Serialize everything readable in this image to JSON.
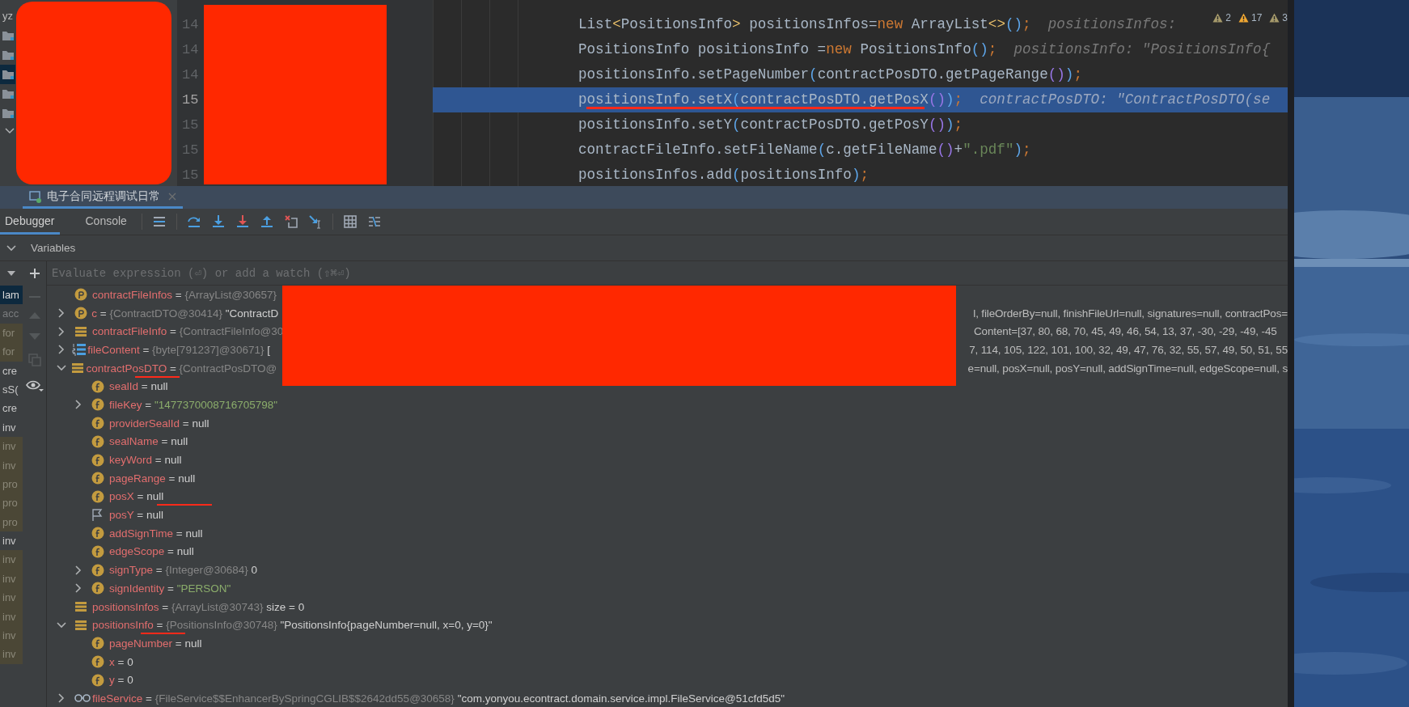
{
  "project_tree": {
    "redacted": true,
    "root_label": "yz",
    "folders": [
      {
        "selected": false
      },
      {
        "selected": false
      },
      {
        "selected": true
      },
      {
        "selected": false
      },
      {
        "selected": false
      }
    ]
  },
  "editor": {
    "gutter_redacted": true,
    "line_numbers": [
      {
        "text": "14",
        "current": false
      },
      {
        "text": "14",
        "current": false
      },
      {
        "text": "14",
        "current": false
      },
      {
        "text": "15",
        "current": true
      },
      {
        "text": "15",
        "current": false
      },
      {
        "text": "15",
        "current": false
      },
      {
        "text": "15",
        "current": false
      }
    ],
    "lines": [
      {
        "selected": false,
        "underlined": false,
        "tokens": [
          {
            "text": "List",
            "kind": "text"
          },
          {
            "text": "<",
            "kind": "generic"
          },
          {
            "text": "PositionsInfo",
            "kind": "text"
          },
          {
            "text": ">",
            "kind": "generic"
          },
          {
            "text": " positionsInfos=",
            "kind": "text"
          },
          {
            "text": "new",
            "kind": "keyword"
          },
          {
            "text": " ArrayList",
            "kind": "text"
          },
          {
            "text": "<>",
            "kind": "generic"
          },
          {
            "text": "()",
            "kind": "paren1"
          },
          {
            "text": ";",
            "kind": "keyword"
          }
        ],
        "hint": "positionsInfos:"
      },
      {
        "selected": false,
        "underlined": false,
        "tokens": [
          {
            "text": "PositionsInfo positionsInfo =",
            "kind": "text"
          },
          {
            "text": "new",
            "kind": "keyword"
          },
          {
            "text": " PositionsInfo",
            "kind": "text"
          },
          {
            "text": "()",
            "kind": "paren1"
          },
          {
            "text": ";",
            "kind": "keyword"
          }
        ],
        "hint": "positionsInfo: \"PositionsInfo{"
      },
      {
        "selected": false,
        "underlined": false,
        "tokens": [
          {
            "text": "positionsInfo.setPageNumber",
            "kind": "text"
          },
          {
            "text": "(",
            "kind": "paren1"
          },
          {
            "text": "contractPosDTO.getPageRange",
            "kind": "text"
          },
          {
            "text": "()",
            "kind": "paren2"
          },
          {
            "text": ")",
            "kind": "paren1"
          },
          {
            "text": ";",
            "kind": "keyword"
          }
        ]
      },
      {
        "selected": true,
        "underlined": true,
        "tokens": [
          {
            "text": "positionsInfo.setX",
            "kind": "text"
          },
          {
            "text": "(",
            "kind": "paren1"
          },
          {
            "text": "contractPosDTO.getPosX",
            "kind": "text"
          },
          {
            "text": "()",
            "kind": "paren2"
          },
          {
            "text": ")",
            "kind": "paren1"
          },
          {
            "text": ";",
            "kind": "keyword"
          }
        ],
        "hint": "contractPosDTO: \"ContractPosDTO(se"
      },
      {
        "selected": false,
        "underlined": false,
        "tokens": [
          {
            "text": "positionsInfo.setY",
            "kind": "text"
          },
          {
            "text": "(",
            "kind": "paren1"
          },
          {
            "text": "contractPosDTO.getPosY",
            "kind": "text"
          },
          {
            "text": "()",
            "kind": "paren2"
          },
          {
            "text": ")",
            "kind": "paren1"
          },
          {
            "text": ";",
            "kind": "keyword"
          }
        ]
      },
      {
        "selected": false,
        "underlined": false,
        "tokens": [
          {
            "text": "contractFileInfo.setFileName",
            "kind": "text"
          },
          {
            "text": "(",
            "kind": "paren1"
          },
          {
            "text": "c.getFileName",
            "kind": "text"
          },
          {
            "text": "()",
            "kind": "paren2"
          },
          {
            "text": "+",
            "kind": "text"
          },
          {
            "text": "\".pdf\"",
            "kind": "string"
          },
          {
            "text": ")",
            "kind": "paren1"
          },
          {
            "text": ";",
            "kind": "keyword"
          }
        ]
      },
      {
        "selected": false,
        "underlined": false,
        "tokens": [
          {
            "text": "positionsInfos.add",
            "kind": "text"
          },
          {
            "text": "(",
            "kind": "paren1"
          },
          {
            "text": "positionsInfo",
            "kind": "text"
          },
          {
            "text": ")",
            "kind": "paren1"
          },
          {
            "text": ";",
            "kind": "keyword"
          }
        ]
      }
    ],
    "inspections": [
      {
        "kind": "weak",
        "count": "2"
      },
      {
        "kind": "warning",
        "count": "17"
      },
      {
        "kind": "weak",
        "count": "3"
      }
    ]
  },
  "tool_window_tab": {
    "label": "电子合同远程调试日常",
    "selected": true
  },
  "debug_tabs": [
    {
      "label": "Debugger",
      "selected": true
    },
    {
      "label": "Console",
      "selected": false
    }
  ],
  "toolbar": [
    {
      "kind": "list"
    },
    {
      "kind": "step-over"
    },
    {
      "kind": "step-into"
    },
    {
      "kind": "force-step-into"
    },
    {
      "kind": "step-out"
    },
    {
      "kind": "drop-frame"
    },
    {
      "kind": "run-to-cursor"
    },
    {
      "kind": "evaluate"
    },
    {
      "kind": "trace"
    }
  ],
  "variables_header": {
    "title": "Variables",
    "expanded": true
  },
  "evaluate_field": {
    "placeholder": "Evaluate expression (⏎) or add a watch (⇧⌘⏎)"
  },
  "frames": [
    {
      "text": "lam",
      "kind": "current"
    },
    {
      "text": "acc",
      "kind": "dim"
    },
    {
      "text": "for",
      "kind": "library"
    },
    {
      "text": "for",
      "kind": "library"
    },
    {
      "text": "cre",
      "kind": "app"
    },
    {
      "text": "sS(",
      "kind": "app"
    },
    {
      "text": "cre",
      "kind": "app"
    },
    {
      "text": "inv",
      "kind": "app"
    },
    {
      "text": "inv",
      "kind": "library"
    },
    {
      "text": "inv",
      "kind": "library"
    },
    {
      "text": "pro",
      "kind": "library"
    },
    {
      "text": "pro",
      "kind": "library"
    },
    {
      "text": "pro",
      "kind": "library"
    },
    {
      "text": "inv",
      "kind": "app"
    },
    {
      "text": "inv",
      "kind": "library"
    },
    {
      "text": "inv",
      "kind": "library"
    },
    {
      "text": "inv",
      "kind": "library"
    },
    {
      "text": "inv",
      "kind": "library"
    },
    {
      "text": "inv",
      "kind": "library"
    },
    {
      "text": "inv",
      "kind": "library"
    }
  ],
  "variables_redacted": true,
  "variables": [
    {
      "kind": "p",
      "name": "contractFileInfos",
      "op": "=",
      "type": "{ArrayList@30657}"
    },
    {
      "kind": "p",
      "expanded": false,
      "name": "c",
      "op": "=",
      "type": "{ContractDTO@30414}",
      "value": "\"ContractD",
      "tail": "l, fileOrderBy=null, finishFileUrl=null, signatures=null, contractPos="
    },
    {
      "kind": "stack",
      "expanded": false,
      "name": "contractFileInfo",
      "op": "=",
      "type": "{ContractFileInfo@30",
      "tail": "Content=[37, 80, 68, 70, 45, 49, 46, 54, 13, 37, -30, -29, -49, -45"
    },
    {
      "kind": "array",
      "expanded": false,
      "name": "fileContent",
      "op": "=",
      "type": "{byte[791237]@30671}",
      "value": "[",
      "tail": "7, 114, 105, 122, 101, 100, 32, 49, 47, 76, 32, 55, 57, 49, 50, 51, 55"
    },
    {
      "kind": "stack",
      "expanded": true,
      "name_underlined": true,
      "name": "contractPosDTO",
      "op": "=",
      "type": "{ContractPosDTO@",
      "tail": "e=null, posX=null, posY=null, addSignTime=null, edgeScope=null, s",
      "children": [
        {
          "kind": "f",
          "name": "sealId",
          "op": "=",
          "value": "null"
        },
        {
          "kind": "f",
          "expanded": false,
          "name": "fileKey",
          "op": "=",
          "value": "\"1477370008716705798\"",
          "string_value": true
        },
        {
          "kind": "f",
          "name": "providerSealId",
          "op": "=",
          "value": "null"
        },
        {
          "kind": "f",
          "name": "sealName",
          "op": "=",
          "value": "null"
        },
        {
          "kind": "f",
          "name": "keyWord",
          "op": "=",
          "value": "null"
        },
        {
          "kind": "f",
          "name": "pageRange",
          "op": "=",
          "value": "null"
        },
        {
          "kind": "f",
          "value_underlined": true,
          "name": "posX",
          "op": "=",
          "value": "null"
        },
        {
          "kind": "flag",
          "name": "posY",
          "op": "=",
          "value": "null"
        },
        {
          "kind": "f",
          "name": "addSignTime",
          "op": "=",
          "value": "null"
        },
        {
          "kind": "f",
          "name": "edgeScope",
          "op": "=",
          "value": "null"
        },
        {
          "kind": "f",
          "expanded": false,
          "name": "signType",
          "op": "=",
          "type": "{Integer@30684}",
          "value": "0"
        },
        {
          "kind": "f",
          "expanded": false,
          "name": "signIdentity",
          "op": "=",
          "value": "\"PERSON\"",
          "string_value": true
        }
      ]
    },
    {
      "kind": "stack",
      "name": "positionsInfos",
      "op": "=",
      "type": "{ArrayList@30743}",
      "value": "size = 0"
    },
    {
      "kind": "stack",
      "expanded": true,
      "name_underlined": true,
      "name": "positionsInfo",
      "op": "=",
      "type": "{PositionsInfo@30748}",
      "value": "\"PositionsInfo{pageNumber=null, x=0, y=0}\"",
      "children": [
        {
          "kind": "f",
          "name": "pageNumber",
          "op": "=",
          "value": "null"
        },
        {
          "kind": "f",
          "name": "x",
          "op": "=",
          "value": "0"
        },
        {
          "kind": "f",
          "name": "y",
          "op": "=",
          "value": "0"
        }
      ]
    },
    {
      "kind": "glasses",
      "expanded": false,
      "name": "fileService",
      "op": "=",
      "type": "{FileService$$EnhancerBySpringCGLIB$$2642dd55@30658}",
      "value": "\"com.yonyou.econtract.domain.service.impl.FileService@51cfd5d5\""
    }
  ]
}
